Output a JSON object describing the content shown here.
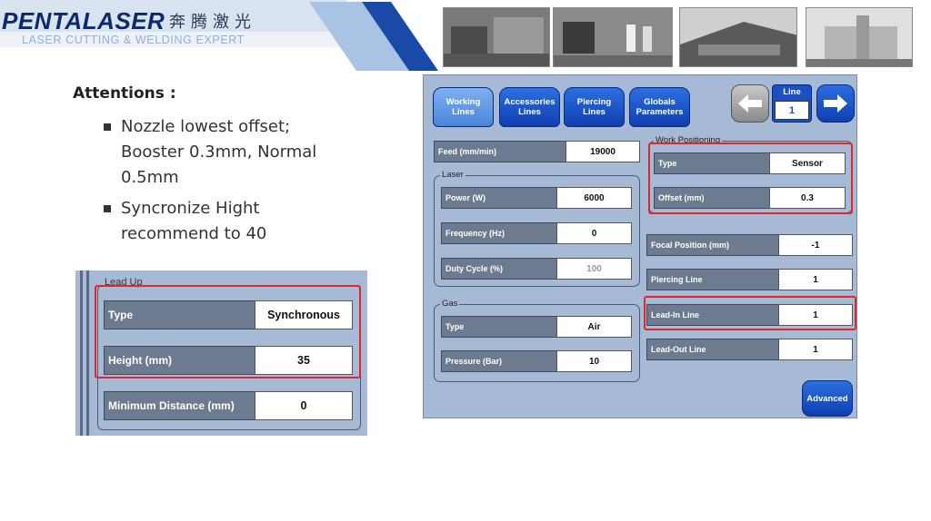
{
  "header": {
    "logo_text": "PENTALASER",
    "logo_chinese": "奔腾激光",
    "tagline": "LASER CUTTING & WELDING EXPERT",
    "brand_color": "#0a2a6a"
  },
  "notes": {
    "title": "Attentions :",
    "bullets": [
      "Nozzle lowest offset; Booster 0.3mm, Normal 0.5mm",
      "Syncronize Hight recommend to 40"
    ]
  },
  "lead_up": {
    "legend": "Lead Up",
    "fields": [
      {
        "label": "Type",
        "value": "Synchronous"
      },
      {
        "label": "Height (mm)",
        "value": "35"
      },
      {
        "label": "Minimum Distance (mm)",
        "value": "0"
      }
    ]
  },
  "panel": {
    "tabs": [
      {
        "line1": "Working",
        "line2": "Lines",
        "active": true
      },
      {
        "line1": "Accessories",
        "line2": "Lines",
        "active": false
      },
      {
        "line1": "Piercing",
        "line2": "Lines",
        "active": false
      },
      {
        "line1": "Globals",
        "line2": "Parameters",
        "active": false
      }
    ],
    "line_selector": {
      "label": "Line",
      "value": "1"
    },
    "feed": {
      "label": "Feed (mm/min)",
      "value": "19000"
    },
    "laser": {
      "legend": "Laser",
      "fields": [
        {
          "label": "Power (W)",
          "value": "6000"
        },
        {
          "label": "Frequency (Hz)",
          "value": "0"
        },
        {
          "label": "Duty Cycle (%)",
          "value": "100"
        }
      ]
    },
    "gas": {
      "legend": "Gas",
      "fields": [
        {
          "label": "Type",
          "value": "Air"
        },
        {
          "label": "Pressure (Bar)",
          "value": "10"
        }
      ]
    },
    "work_positioning": {
      "legend": "Work Positioning",
      "fields": [
        {
          "label": "Type",
          "value": "Sensor"
        },
        {
          "label": "Offset (mm)",
          "value": "0.3"
        }
      ]
    },
    "right_fields": [
      {
        "label": "Focal Position (mm)",
        "value": "-1"
      },
      {
        "label": "Piercing Line",
        "value": "1"
      },
      {
        "label": "Lead-In Line",
        "value": "1"
      },
      {
        "label": "Lead-Out Line",
        "value": "1"
      }
    ],
    "advanced_label": "Advanced"
  },
  "colors": {
    "panel_bg": "#a7bad5",
    "label_bg": "#6d7b91",
    "button_blue": "#1c4fc2",
    "highlight": "#e0282b"
  }
}
